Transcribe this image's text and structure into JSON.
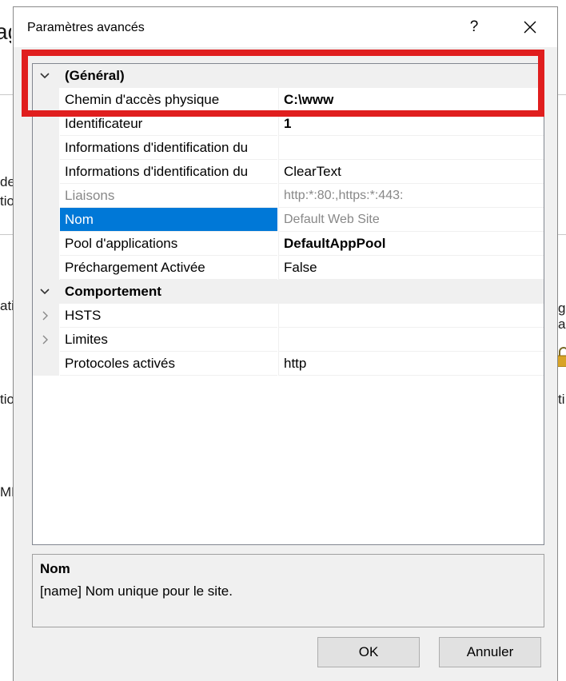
{
  "background": {
    "title_fragment": "ag",
    "left_fragments": [
      "de",
      "tio",
      "ati",
      "tio",
      "ME"
    ],
    "right_fragments": [
      "g",
      "a",
      "ti"
    ]
  },
  "dialog": {
    "title": "Paramètres avancés",
    "help_label": "?"
  },
  "grid": {
    "categories": {
      "general": "(Général)",
      "behavior": "Comportement"
    },
    "rows": [
      {
        "name": "Chemin d'accès physique",
        "value": "C:\\www"
      },
      {
        "name": "Identificateur",
        "value": "1"
      },
      {
        "name": "Informations d'identification du",
        "value": ""
      },
      {
        "name": "Informations d'identification du",
        "value": "ClearText"
      },
      {
        "name": "Liaisons",
        "value": "http:*:80:,https:*:443:"
      },
      {
        "name": "Nom",
        "value": "Default Web Site"
      },
      {
        "name": "Pool d'applications",
        "value": "DefaultAppPool"
      },
      {
        "name": "Préchargement Activée",
        "value": "False"
      },
      {
        "name": "HSTS",
        "value": ""
      },
      {
        "name": "Limites",
        "value": ""
      },
      {
        "name": "Protocoles activés",
        "value": "http"
      }
    ]
  },
  "description": {
    "title": "Nom",
    "text": "[name] Nom unique pour le site."
  },
  "buttons": {
    "ok": "OK",
    "cancel": "Annuler"
  },
  "colors": {
    "selection": "#0078d7",
    "highlight": "#e01e1e"
  },
  "icons": {
    "expanded": "chevron-down-icon",
    "collapsed": "chevron-right-icon",
    "close": "close-icon",
    "lock": "lock-icon"
  }
}
